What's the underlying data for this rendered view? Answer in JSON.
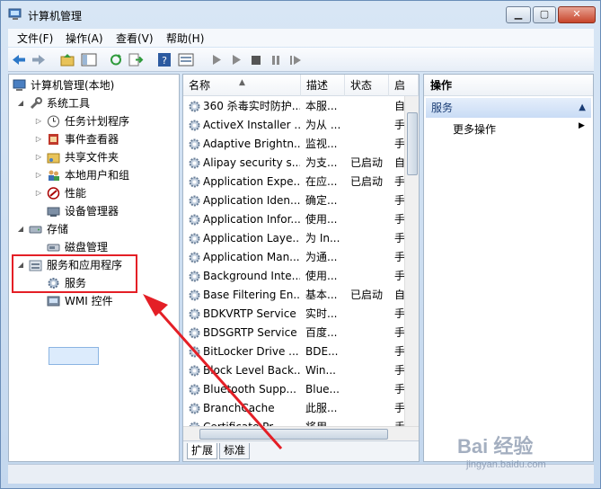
{
  "window": {
    "title": "计算机管理"
  },
  "menu": [
    "文件(F)",
    "操作(A)",
    "查看(V)",
    "帮助(H)"
  ],
  "toolbar": {
    "icons": [
      "back-arrow-icon",
      "forward-arrow-icon",
      "up-folder-icon",
      "show-hide-tree-icon",
      "refresh-icon",
      "export-icon",
      "help-icon",
      "properties-icon",
      "play-icon",
      "play-outline-icon",
      "stop-icon",
      "pause-icon",
      "restart-icon"
    ]
  },
  "tree": {
    "root": "计算机管理(本地)",
    "system_tools": "系统工具",
    "task_scheduler": "任务计划程序",
    "event_viewer": "事件查看器",
    "shared_folders": "共享文件夹",
    "local_users": "本地用户和组",
    "performance": "性能",
    "device_manager": "设备管理器",
    "storage": "存储",
    "disk_management": "磁盘管理",
    "services_apps": "服务和应用程序",
    "services": "服务",
    "wmi": "WMI 控件"
  },
  "list": {
    "columns": {
      "name": "名称",
      "description": "描述",
      "status": "状态",
      "startup": "启"
    },
    "rows": [
      {
        "name": "360 杀毒实时防护...",
        "description": "本服...",
        "status": "",
        "startup": "自"
      },
      {
        "name": "ActiveX Installer ...",
        "description": "为从 ...",
        "status": "",
        "startup": "手"
      },
      {
        "name": "Adaptive Brightn...",
        "description": "监视...",
        "status": "",
        "startup": "手"
      },
      {
        "name": "Alipay security s...",
        "description": "为支...",
        "status": "已启动",
        "startup": "自"
      },
      {
        "name": "Application Expe...",
        "description": "在应...",
        "status": "已启动",
        "startup": "手"
      },
      {
        "name": "Application Iden...",
        "description": "确定...",
        "status": "",
        "startup": "手"
      },
      {
        "name": "Application Infor...",
        "description": "使用...",
        "status": "",
        "startup": "手"
      },
      {
        "name": "Application Laye...",
        "description": "为 In...",
        "status": "",
        "startup": "手"
      },
      {
        "name": "Application Man...",
        "description": "为通...",
        "status": "",
        "startup": "手"
      },
      {
        "name": "Background Inte...",
        "description": "使用...",
        "status": "",
        "startup": "手"
      },
      {
        "name": "Base Filtering En...",
        "description": "基本...",
        "status": "已启动",
        "startup": "自"
      },
      {
        "name": "BDKVRTP Service",
        "description": "实时...",
        "status": "",
        "startup": "手"
      },
      {
        "name": "BDSGRTP Service",
        "description": "百度...",
        "status": "",
        "startup": "手"
      },
      {
        "name": "BitLocker Drive ...",
        "description": "BDE...",
        "status": "",
        "startup": "手"
      },
      {
        "name": "Block Level Back...",
        "description": "Win...",
        "status": "",
        "startup": "手"
      },
      {
        "name": "Bluetooth Supp...",
        "description": "Blue...",
        "status": "",
        "startup": "手"
      },
      {
        "name": "BranchCache",
        "description": "此服...",
        "status": "",
        "startup": "手"
      },
      {
        "name": "Certificate Pr...",
        "description": "将用...",
        "status": "",
        "startup": "手"
      }
    ],
    "tabs": {
      "extended": "扩展",
      "standard": "标准"
    }
  },
  "actions": {
    "title": "操作",
    "group": "服务",
    "more": "更多操作"
  },
  "watermark": {
    "main": "Bai 经验",
    "sub": "jingyan.baidu.com"
  },
  "colors": {
    "highlight_red": "#e41f26",
    "selection_blue": "#dcebfc"
  }
}
